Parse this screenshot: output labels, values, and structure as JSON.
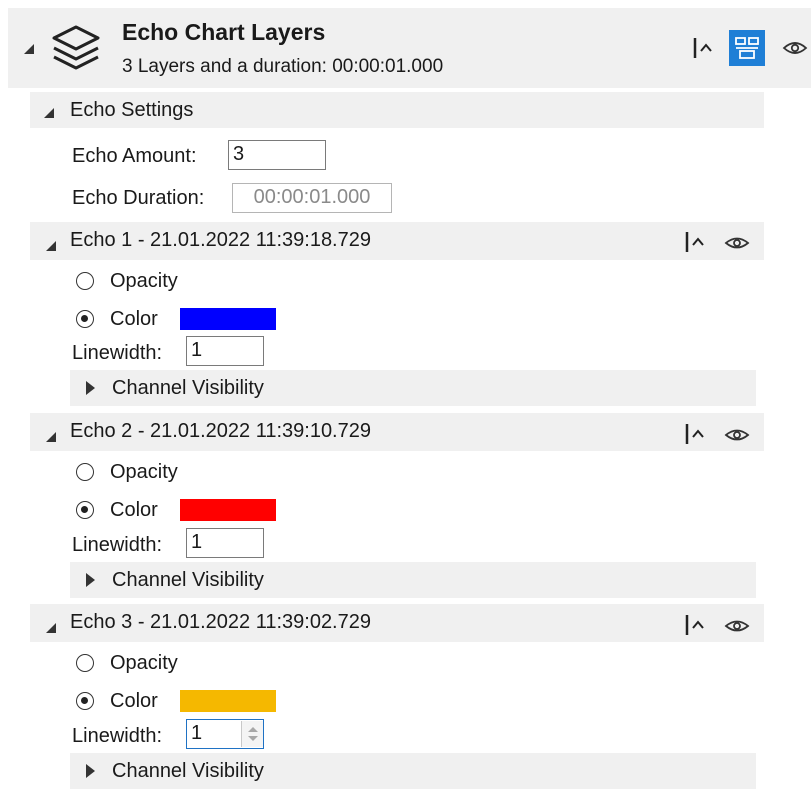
{
  "header": {
    "title": "Echo Chart Layers",
    "subtitle": "3 Layers and a duration: 00:00:01.000"
  },
  "settings": {
    "heading": "Echo Settings",
    "amount_label": "Echo Amount:",
    "amount_value": "3",
    "duration_label": "Echo Duration:",
    "duration_value": "00:00:01.000"
  },
  "echoes": [
    {
      "title": "Echo 1 - 21.01.2022 11:39:18.729",
      "opacity_label": "Opacity",
      "color_label": "Color",
      "color": "#0000ff",
      "linewidth_label": "Linewidth:",
      "linewidth_value": "1",
      "channel_label": "Channel Visibility"
    },
    {
      "title": "Echo 2 - 21.01.2022 11:39:10.729",
      "opacity_label": "Opacity",
      "color_label": "Color",
      "color": "#ff0000",
      "linewidth_label": "Linewidth:",
      "linewidth_value": "1",
      "channel_label": "Channel Visibility"
    },
    {
      "title": "Echo 3 - 21.01.2022 11:39:02.729",
      "opacity_label": "Opacity",
      "color_label": "Color",
      "color": "#f5b800",
      "linewidth_label": "Linewidth:",
      "linewidth_value": "1",
      "channel_label": "Channel Visibility"
    }
  ],
  "colors": {
    "section_bg": "#f0f0f0",
    "accent": "#1f7fd6"
  }
}
